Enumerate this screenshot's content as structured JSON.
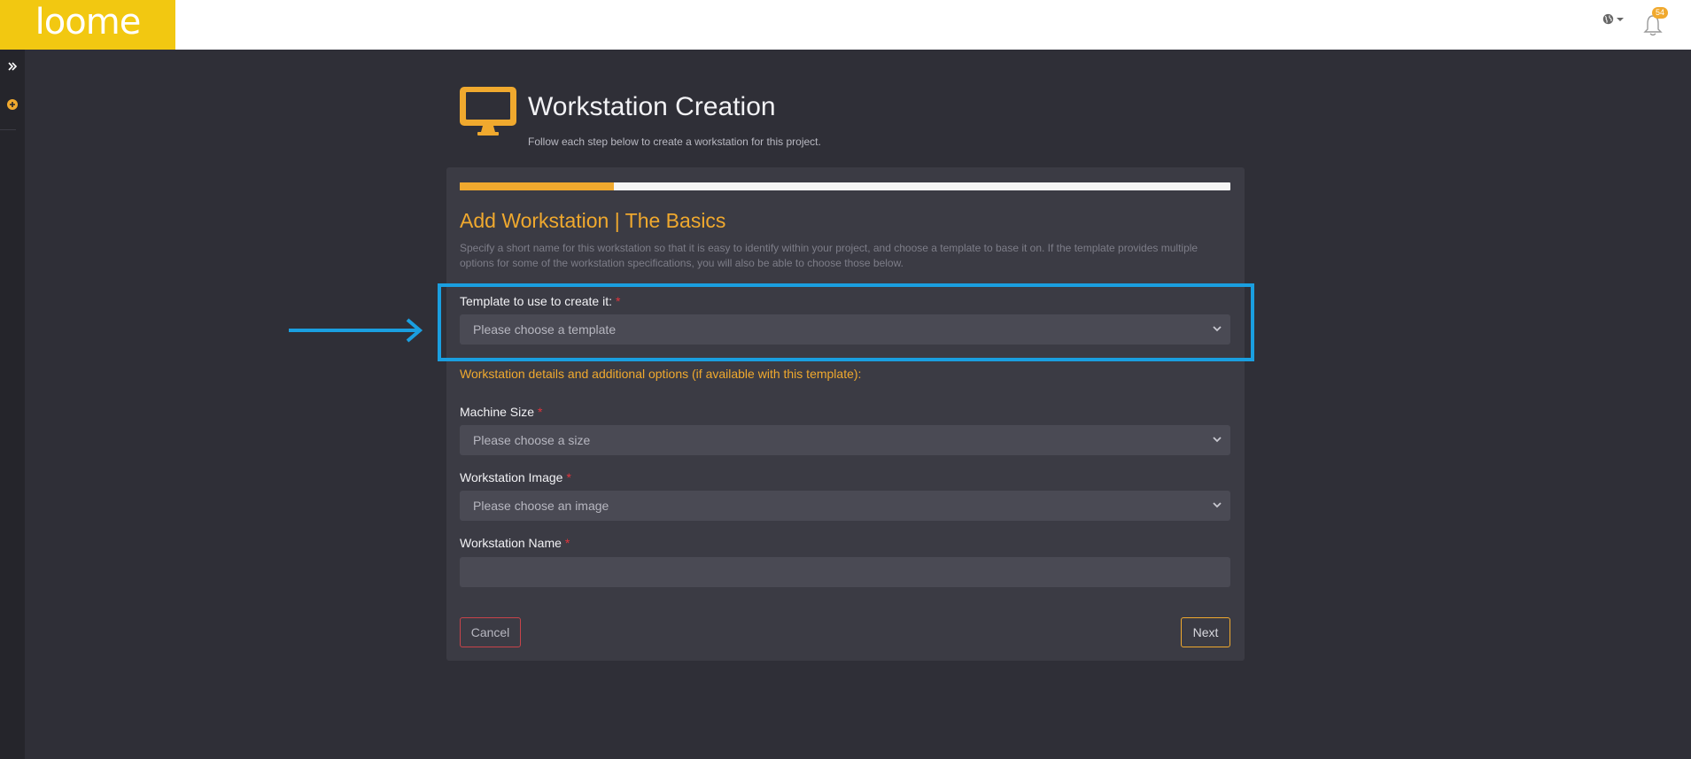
{
  "brand": {
    "logo_text": "loome",
    "logo_color": "#f2c811"
  },
  "topbar": {
    "globe_icon": "globe-icon",
    "notifications": {
      "icon": "bell-icon",
      "count": "54"
    }
  },
  "sidebar": {
    "items": [
      {
        "icon": "double-chevron-right-icon",
        "label": "Expand"
      },
      {
        "icon": "plus-circle-icon",
        "label": "Add"
      }
    ]
  },
  "header": {
    "icon": "monitor-icon",
    "title": "Workstation Creation",
    "subtitle": "Follow each step below to create a workstation for this project."
  },
  "wizard": {
    "progress": 0.2,
    "title": "Add Workstation | The Basics",
    "description": "Specify a short name for this workstation so that it is easy to identify within your project, and choose a template to base it on. If the template provides multiple options for some of the workstation specifications, you will also be able to choose those below.",
    "template": {
      "label": "Template to use to create it:",
      "placeholder": "Please choose a template"
    },
    "details_note": "Workstation details and additional options (if available with this template):",
    "machine_size": {
      "label": "Machine Size",
      "placeholder": "Please choose a size"
    },
    "image": {
      "label": "Workstation Image",
      "placeholder": "Please choose an image"
    },
    "name": {
      "label": "Workstation Name",
      "value": ""
    },
    "required_marker": "*",
    "cancel_label": "Cancel",
    "next_label": "Next"
  },
  "colors": {
    "accent": "#f0a92e",
    "background": "#2f2f37",
    "card": "#3b3b44",
    "annotation": "#1a9fe0",
    "required": "#e0343c"
  }
}
